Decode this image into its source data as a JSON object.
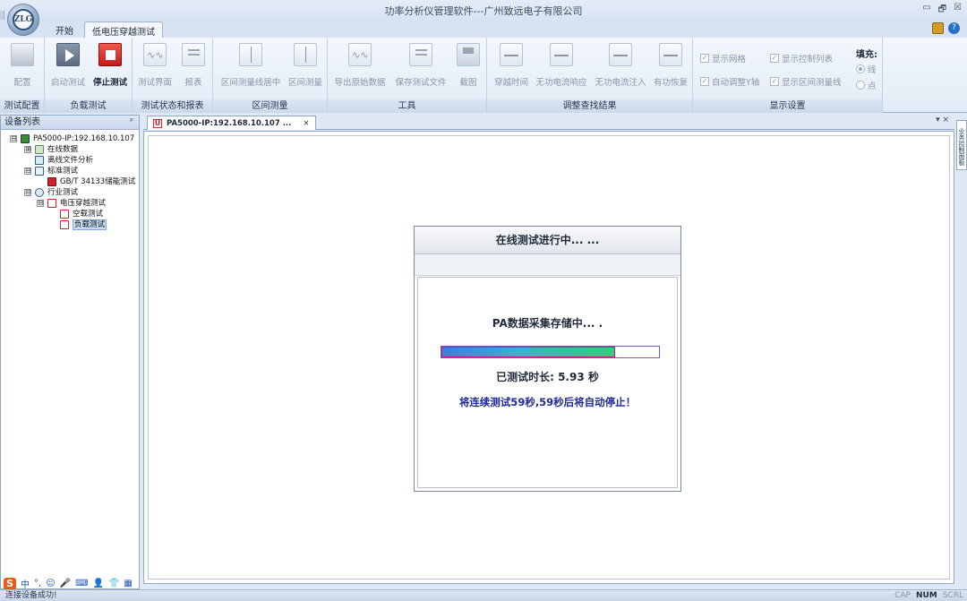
{
  "window": {
    "title": "功率分析仪管理软件---广州致远电子有限公司",
    "controls": [
      "▭",
      "🗗",
      "☒"
    ],
    "orb_text": "ZLG"
  },
  "ribbon": {
    "tabs": [
      "开始",
      "低电压穿越测试"
    ],
    "active_tab": "低电压穿越测试",
    "groups": [
      {
        "label": "测试配置",
        "buttons": [
          "配置"
        ]
      },
      {
        "label": "负载测试",
        "buttons": [
          "启动测试",
          "停止测试"
        ]
      },
      {
        "label": "测试状态和报表",
        "buttons": [
          "测试界面",
          "报表"
        ]
      },
      {
        "label": "区间测量",
        "buttons": [
          "区间测量线居中",
          "区间测量"
        ]
      },
      {
        "label": "工具",
        "buttons": [
          "导出原始数据",
          "保存测试文件",
          "截图"
        ]
      },
      {
        "label": "调整查找结果",
        "buttons": [
          "穿越时间",
          "无功电流响应",
          "无功电流注入",
          "有功恢复"
        ]
      },
      {
        "label": "显示设置",
        "checks": [
          "显示网格",
          "显示控制列表",
          "自动调整Y轴",
          "显示区间测量线"
        ],
        "fill_label": "填充:",
        "fill_options": [
          "线",
          "点"
        ]
      }
    ]
  },
  "side_panel": {
    "title": "设备列表",
    "pin": "ᵖ",
    "tree": [
      {
        "label": "PA5000-IP:192.168.10.107",
        "expander": "⊟"
      },
      {
        "label": "在线数据",
        "expander": "⊞"
      },
      {
        "label": "离线文件分析"
      },
      {
        "label": "标准测试",
        "expander": "⊟"
      },
      {
        "label": "GB/T 34133储能测试"
      },
      {
        "label": "行业测试",
        "expander": "⊟"
      },
      {
        "label": "电压穿越测试",
        "expander": "⊟"
      },
      {
        "label": "空载测试"
      },
      {
        "label": "负载测试"
      }
    ]
  },
  "doc_tab": {
    "label": "PA5000-IP:192.168.10.107 ...",
    "icon": "U",
    "close": "×",
    "controls": "▾ ×"
  },
  "right_strip": {
    "label": "业务控制面板"
  },
  "dialog": {
    "title": "在线测试进行中... ...",
    "collecting": "PA数据采集存储中... .",
    "progress": 0.8,
    "elapsed": "已测试时长: 5.93 秒",
    "auto_stop": "将连续测试59秒,59秒后将自动停止！"
  },
  "ime": {
    "logo": "S",
    "items": [
      "中",
      "°,",
      "☺",
      "🎤",
      "⌨",
      "👤",
      "👕",
      "▦"
    ]
  },
  "status": {
    "text": "连接设备成功!",
    "keys": [
      "CAP",
      "NUM",
      "SCRL"
    ],
    "active_key": "NUM"
  }
}
